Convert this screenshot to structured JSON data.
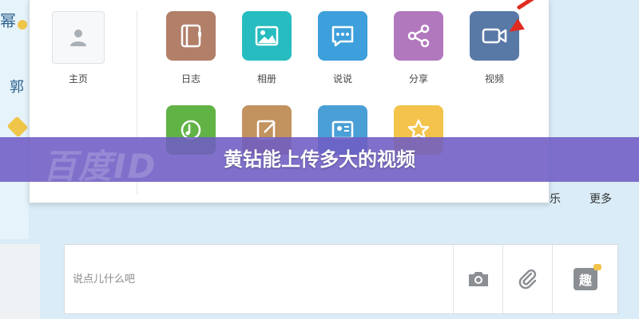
{
  "left_fragments": {
    "top": "幂",
    "mid": "郭"
  },
  "popup": {
    "home": {
      "label": "主页",
      "icon": "user-icon"
    },
    "apps_row1": [
      {
        "label": "日志",
        "icon": "notebook-icon",
        "color": "#b27f69"
      },
      {
        "label": "相册",
        "icon": "photo-icon",
        "color": "#27bcc0"
      },
      {
        "label": "说说",
        "icon": "chat-bubble-icon",
        "color": "#3d9fdb"
      },
      {
        "label": "分享",
        "icon": "share-icon",
        "color": "#b278be"
      },
      {
        "label": "视频",
        "icon": "video-camera-icon",
        "color": "#5879a6"
      }
    ],
    "apps_row2_icons": [
      {
        "icon": "music-icon",
        "color": "#62b346"
      },
      {
        "icon": "edit-icon",
        "color": "#c2935f"
      },
      {
        "icon": "profile-card-icon",
        "color": "#4aa0d6"
      },
      {
        "icon": "star-icon",
        "color": "#f3c34b"
      }
    ]
  },
  "banner": {
    "title": "黄钻能上传多大的视频",
    "watermark": "百度ID",
    "color": "#6e5cc4"
  },
  "right_links": {
    "a": "乐",
    "b": "更多"
  },
  "composer": {
    "placeholder": "说点儿什么吧",
    "tools": [
      {
        "icon": "camera-icon"
      },
      {
        "icon": "paperclip-icon"
      },
      {
        "icon": "fun-badge-icon",
        "label": "趣"
      }
    ]
  },
  "colors": {
    "arrow": "#e02b20",
    "background": "#d9ecf7"
  }
}
